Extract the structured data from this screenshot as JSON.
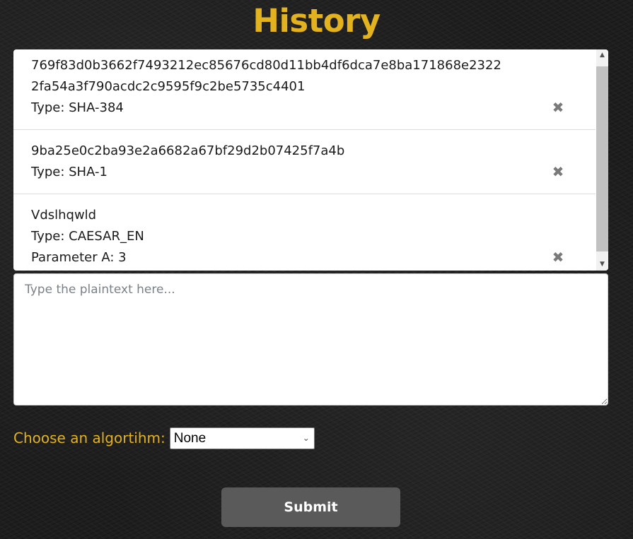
{
  "page": {
    "title": "History"
  },
  "colors": {
    "accent": "#e2b21f",
    "background": "#1e1e1e",
    "button": "#5a5a5a"
  },
  "history": {
    "remove_icon": "close-icon",
    "items": [
      {
        "lines": [
          "769f83d0b3662f7493212ec85676cd80d11bb4df6dca7e8ba171868e2322",
          "2fa54a3f790acdc2c9595f9c2be5735c4401",
          "Type: SHA-384"
        ]
      },
      {
        "lines": [
          "9ba25e0c2ba93e2a6682a67bf29d2b07425f7a4b",
          "Type: SHA-1"
        ]
      },
      {
        "lines": [
          "Vdslhqwld",
          "Type: CAESAR_EN",
          "Parameter A: 3"
        ]
      }
    ]
  },
  "plaintext": {
    "placeholder": "Type the plaintext here...",
    "value": ""
  },
  "algorithm": {
    "label": "Choose an algortihm:",
    "selected": "None"
  },
  "submit": {
    "label": "Submit"
  }
}
